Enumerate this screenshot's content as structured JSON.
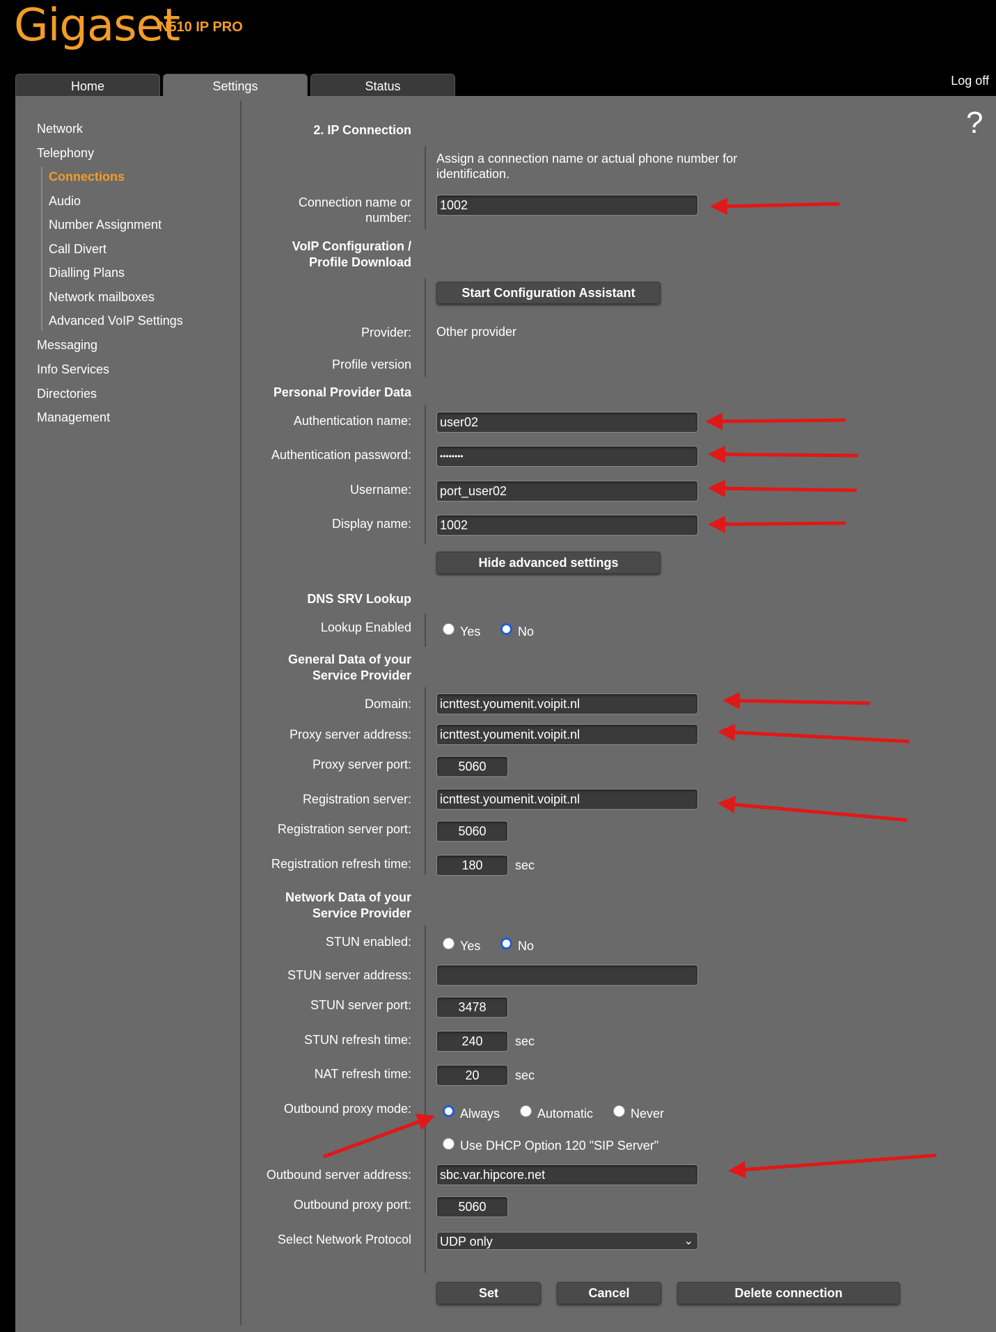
{
  "header": {
    "brand": "Gigaset",
    "model": "N510 IP PRO",
    "logoff": "Log off",
    "help": "?"
  },
  "tabs": [
    {
      "label": "Home"
    },
    {
      "label": "Settings"
    },
    {
      "label": "Status"
    }
  ],
  "sidebar": {
    "items": [
      {
        "label": "Network"
      },
      {
        "label": "Telephony"
      },
      {
        "label": "Connections"
      },
      {
        "label": "Audio"
      },
      {
        "label": "Number Assignment"
      },
      {
        "label": "Call Divert"
      },
      {
        "label": "Dialling Plans"
      },
      {
        "label": "Network mailboxes"
      },
      {
        "label": "Advanced VoIP Settings"
      },
      {
        "label": "Messaging"
      },
      {
        "label": "Info Services"
      },
      {
        "label": "Directories"
      },
      {
        "label": "Management"
      }
    ]
  },
  "form": {
    "section_ip": "2. IP Connection",
    "assign_hint": "Assign a connection name or actual phone number for identification.",
    "conn_name_label": "Connection name or number:",
    "conn_name_value": "1002",
    "voip_section": "VoIP Configuration / Profile Download",
    "start_assistant": "Start Configuration Assistant",
    "provider_label": "Provider:",
    "provider_value": "Other provider",
    "profile_version_label": "Profile version",
    "personal_section": "Personal Provider Data",
    "auth_name_label": "Authentication name:",
    "auth_name_value": "user02",
    "auth_pw_label": "Authentication password:",
    "auth_pw_value": "••••••••",
    "username_label": "Username:",
    "username_value": "port_user02",
    "display_label": "Display name:",
    "display_value": "1002",
    "hide_advanced": "Hide advanced settings",
    "dns_section": "DNS SRV Lookup",
    "lookup_label": "Lookup Enabled",
    "yes": "Yes",
    "no": "No",
    "general_section": "General Data of your Service Provider",
    "domain_label": "Domain:",
    "domain_value": "icnttest.youmenit.voipit.nl",
    "proxy_label": "Proxy server address:",
    "proxy_value": "icnttest.youmenit.voipit.nl",
    "proxy_port_label": "Proxy server port:",
    "proxy_port_value": "5060",
    "reg_server_label": "Registration server:",
    "reg_server_value": "icnttest.youmenit.voipit.nl",
    "reg_port_label": "Registration server port:",
    "reg_port_value": "5060",
    "reg_refresh_label": "Registration refresh time:",
    "reg_refresh_value": "180",
    "sec": "sec",
    "network_section": "Network Data of your Service Provider",
    "stun_enabled_label": "STUN enabled:",
    "stun_addr_label": "STUN server address:",
    "stun_addr_value": "",
    "stun_port_label": "STUN server port:",
    "stun_port_value": "3478",
    "stun_refresh_label": "STUN refresh time:",
    "stun_refresh_value": "240",
    "nat_refresh_label": "NAT refresh time:",
    "nat_refresh_value": "20",
    "outbound_mode_label": "Outbound proxy mode:",
    "always": "Always",
    "automatic": "Automatic",
    "never": "Never",
    "dhcp_option": "Use DHCP Option 120 \"SIP Server\"",
    "outbound_addr_label": "Outbound server address:",
    "outbound_addr_value": "sbc.var.hipcore.net",
    "outbound_port_label": "Outbound proxy port:",
    "outbound_port_value": "5060",
    "protocol_label": "Select Network Protocol",
    "protocol_value": "UDP only",
    "set": "Set",
    "cancel": "Cancel",
    "delete": "Delete connection"
  },
  "colors": {
    "accent": "#f39c28",
    "panel": "#6a6a6a",
    "annotation_arrow": "#e01818",
    "radio_selected": "#1a5fd6"
  }
}
